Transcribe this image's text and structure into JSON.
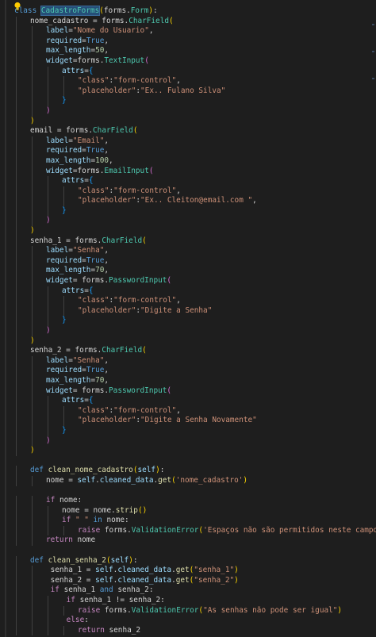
{
  "editor": {
    "theme_colors": {
      "background": "#1e1e1e",
      "keyword": "#569cd6",
      "control": "#c586c0",
      "class": "#4ec9b0",
      "function": "#dcdcaa",
      "string": "#ce9178",
      "number": "#b5cea8",
      "param": "#9cdcfe"
    },
    "lightbulb_icon": "lightbulb-icon",
    "lines": [
      {
        "indent": 0,
        "tokens": [
          [
            "kw",
            "class "
          ],
          [
            "cls hl",
            "CadastroForms"
          ],
          [
            "br1",
            "("
          ],
          [
            "pl",
            "forms."
          ],
          [
            "cls",
            "Form"
          ],
          [
            "br1",
            ")"
          ],
          [
            "pl",
            ":"
          ]
        ]
      },
      {
        "indent": 1,
        "tokens": [
          [
            "pl",
            "nome_cadastro = forms."
          ],
          [
            "cls",
            "CharField"
          ],
          [
            "br1",
            "("
          ]
        ]
      },
      {
        "indent": 2,
        "tokens": [
          [
            "prm",
            "label"
          ],
          [
            "pl",
            "="
          ],
          [
            "str",
            "\"Nome do Usuario\""
          ],
          [
            "pl",
            ","
          ]
        ]
      },
      {
        "indent": 2,
        "tokens": [
          [
            "prm",
            "required"
          ],
          [
            "pl",
            "="
          ],
          [
            "kw",
            "True"
          ],
          [
            "pl",
            ","
          ]
        ]
      },
      {
        "indent": 2,
        "tokens": [
          [
            "prm",
            "max_length"
          ],
          [
            "pl",
            "="
          ],
          [
            "num",
            "50"
          ],
          [
            "pl",
            ","
          ]
        ]
      },
      {
        "indent": 2,
        "tokens": [
          [
            "prm",
            "widget"
          ],
          [
            "pl",
            "=forms."
          ],
          [
            "cls",
            "TextInput"
          ],
          [
            "br2",
            "("
          ]
        ]
      },
      {
        "indent": 3,
        "tokens": [
          [
            "prm",
            "attrs"
          ],
          [
            "pl",
            "="
          ],
          [
            "br3",
            "{"
          ]
        ]
      },
      {
        "indent": 4,
        "tokens": [
          [
            "str",
            "\"class\""
          ],
          [
            "pl",
            ":"
          ],
          [
            "str",
            "\"form-control\""
          ],
          [
            "pl",
            ","
          ]
        ]
      },
      {
        "indent": 4,
        "tokens": [
          [
            "str",
            "\"placeholder\""
          ],
          [
            "pl",
            ":"
          ],
          [
            "str",
            "\"Ex.. Fulano Silva\""
          ]
        ]
      },
      {
        "indent": 3,
        "tokens": [
          [
            "br3",
            "}"
          ]
        ]
      },
      {
        "indent": 2,
        "tokens": [
          [
            "br2",
            ")"
          ]
        ]
      },
      {
        "indent": 1,
        "tokens": [
          [
            "br1",
            ")"
          ]
        ]
      },
      {
        "indent": 1,
        "tokens": [
          [
            "pl",
            "email = forms."
          ],
          [
            "cls",
            "CharField"
          ],
          [
            "br1",
            "("
          ]
        ]
      },
      {
        "indent": 2,
        "tokens": [
          [
            "prm",
            "label"
          ],
          [
            "pl",
            "="
          ],
          [
            "str",
            "\"Email\""
          ],
          [
            "pl",
            ","
          ]
        ]
      },
      {
        "indent": 2,
        "tokens": [
          [
            "prm",
            "required"
          ],
          [
            "pl",
            "="
          ],
          [
            "kw",
            "True"
          ],
          [
            "pl",
            ","
          ]
        ]
      },
      {
        "indent": 2,
        "tokens": [
          [
            "prm",
            "max_length"
          ],
          [
            "pl",
            "="
          ],
          [
            "num",
            "100"
          ],
          [
            "pl",
            ","
          ]
        ]
      },
      {
        "indent": 2,
        "tokens": [
          [
            "prm",
            "widget"
          ],
          [
            "pl",
            "=forms."
          ],
          [
            "cls",
            "EmailInput"
          ],
          [
            "br2",
            "("
          ]
        ]
      },
      {
        "indent": 3,
        "tokens": [
          [
            "prm",
            "attrs"
          ],
          [
            "pl",
            "="
          ],
          [
            "br3",
            "{"
          ]
        ]
      },
      {
        "indent": 4,
        "tokens": [
          [
            "str",
            "\"class\""
          ],
          [
            "pl",
            ":"
          ],
          [
            "str",
            "\"form-control\""
          ],
          [
            "pl",
            ","
          ]
        ]
      },
      {
        "indent": 4,
        "tokens": [
          [
            "str",
            "\"placeholder\""
          ],
          [
            "pl",
            ":"
          ],
          [
            "str",
            "\"Ex.. Cleiton@email.com \""
          ],
          [
            "pl",
            ","
          ]
        ]
      },
      {
        "indent": 3,
        "tokens": [
          [
            "br3",
            "}"
          ]
        ]
      },
      {
        "indent": 2,
        "tokens": [
          [
            "br2",
            ")"
          ]
        ]
      },
      {
        "indent": 1,
        "tokens": [
          [
            "br1",
            ")"
          ]
        ]
      },
      {
        "indent": 1,
        "tokens": [
          [
            "pl",
            "senha_1 = forms."
          ],
          [
            "cls",
            "CharField"
          ],
          [
            "br1",
            "("
          ]
        ]
      },
      {
        "indent": 2,
        "tokens": [
          [
            "prm",
            "label"
          ],
          [
            "pl",
            "="
          ],
          [
            "str",
            "\"Senha\""
          ],
          [
            "pl",
            ","
          ]
        ]
      },
      {
        "indent": 2,
        "tokens": [
          [
            "prm",
            "required"
          ],
          [
            "pl",
            "="
          ],
          [
            "kw",
            "True"
          ],
          [
            "pl",
            ","
          ]
        ]
      },
      {
        "indent": 2,
        "tokens": [
          [
            "prm",
            "max_length"
          ],
          [
            "pl",
            "="
          ],
          [
            "num",
            "70"
          ],
          [
            "pl",
            ","
          ]
        ]
      },
      {
        "indent": 2,
        "tokens": [
          [
            "prm",
            "widget"
          ],
          [
            "pl",
            "= forms."
          ],
          [
            "cls",
            "PasswordInput"
          ],
          [
            "br2",
            "("
          ]
        ]
      },
      {
        "indent": 3,
        "tokens": [
          [
            "prm",
            "attrs"
          ],
          [
            "pl",
            "="
          ],
          [
            "br3",
            "{"
          ]
        ]
      },
      {
        "indent": 4,
        "tokens": [
          [
            "str",
            "\"class\""
          ],
          [
            "pl",
            ":"
          ],
          [
            "str",
            "\"form-control\""
          ],
          [
            "pl",
            ","
          ]
        ]
      },
      {
        "indent": 4,
        "tokens": [
          [
            "str",
            "\"placeholder\""
          ],
          [
            "pl",
            ":"
          ],
          [
            "str",
            "\"Digite a Senha\""
          ]
        ]
      },
      {
        "indent": 3,
        "tokens": [
          [
            "br3",
            "}"
          ]
        ]
      },
      {
        "indent": 2,
        "tokens": [
          [
            "br2",
            ")"
          ]
        ]
      },
      {
        "indent": 1,
        "tokens": [
          [
            "br1",
            ")"
          ]
        ]
      },
      {
        "indent": 1,
        "tokens": [
          [
            "pl",
            "senha_2 = forms."
          ],
          [
            "cls",
            "CharField"
          ],
          [
            "br1",
            "("
          ]
        ]
      },
      {
        "indent": 2,
        "tokens": [
          [
            "prm",
            "label"
          ],
          [
            "pl",
            "="
          ],
          [
            "str",
            "\"Senha\""
          ],
          [
            "pl",
            ","
          ]
        ]
      },
      {
        "indent": 2,
        "tokens": [
          [
            "prm",
            "required"
          ],
          [
            "pl",
            "="
          ],
          [
            "kw",
            "True"
          ],
          [
            "pl",
            ","
          ]
        ]
      },
      {
        "indent": 2,
        "tokens": [
          [
            "prm",
            "max_length"
          ],
          [
            "pl",
            "="
          ],
          [
            "num",
            "70"
          ],
          [
            "pl",
            ","
          ]
        ]
      },
      {
        "indent": 2,
        "tokens": [
          [
            "prm",
            "widget"
          ],
          [
            "pl",
            "= forms."
          ],
          [
            "cls",
            "PasswordInput"
          ],
          [
            "br2",
            "("
          ]
        ]
      },
      {
        "indent": 3,
        "tokens": [
          [
            "prm",
            "attrs"
          ],
          [
            "pl",
            "="
          ],
          [
            "br3",
            "{"
          ]
        ]
      },
      {
        "indent": 4,
        "tokens": [
          [
            "str",
            "\"class\""
          ],
          [
            "pl",
            ":"
          ],
          [
            "str",
            "\"form-control\""
          ],
          [
            "pl",
            ","
          ]
        ]
      },
      {
        "indent": 4,
        "tokens": [
          [
            "str",
            "\"placeholder\""
          ],
          [
            "pl",
            ":"
          ],
          [
            "str",
            "\"Digite a Senha Novamente\""
          ]
        ]
      },
      {
        "indent": 3,
        "tokens": [
          [
            "br3",
            "}"
          ]
        ]
      },
      {
        "indent": 2,
        "tokens": [
          [
            "br2",
            ")"
          ]
        ]
      },
      {
        "indent": 1,
        "tokens": [
          [
            "br1",
            ")"
          ]
        ]
      },
      {
        "indent": 0,
        "tokens": []
      },
      {
        "indent": 1,
        "tokens": [
          [
            "kw",
            "def "
          ],
          [
            "fn",
            "clean_nome_cadastro"
          ],
          [
            "br1",
            "("
          ],
          [
            "self",
            "self"
          ],
          [
            "br1",
            ")"
          ],
          [
            "pl",
            ":"
          ]
        ]
      },
      {
        "indent": 2,
        "tokens": [
          [
            "pl",
            "nome = "
          ],
          [
            "self",
            "self"
          ],
          [
            "pl",
            "."
          ],
          [
            "prm",
            "cleaned_data"
          ],
          [
            "pl",
            "."
          ],
          [
            "fn",
            "get"
          ],
          [
            "br1",
            "("
          ],
          [
            "str",
            "'nome_cadastro'"
          ],
          [
            "br1",
            ")"
          ]
        ]
      },
      {
        "indent": 0,
        "tokens": []
      },
      {
        "indent": 2,
        "tokens": [
          [
            "cf",
            "if "
          ],
          [
            "pl",
            "nome:"
          ]
        ]
      },
      {
        "indent": 3,
        "tokens": [
          [
            "pl",
            "nome = nome."
          ],
          [
            "fn",
            "strip"
          ],
          [
            "br1",
            "()"
          ]
        ]
      },
      {
        "indent": 3,
        "tokens": [
          [
            "cf",
            "if "
          ],
          [
            "str",
            "\" \""
          ],
          [
            "kw",
            " in "
          ],
          [
            "pl",
            "nome:"
          ]
        ]
      },
      {
        "indent": 4,
        "tokens": [
          [
            "cf",
            "raise "
          ],
          [
            "pl",
            "forms."
          ],
          [
            "cls",
            "ValidationError"
          ],
          [
            "br1",
            "("
          ],
          [
            "str",
            "'Espaços não são permitidos neste campo'"
          ],
          [
            "br1",
            ")"
          ]
        ]
      },
      {
        "indent": 2,
        "tokens": [
          [
            "cf",
            "return "
          ],
          [
            "pl",
            "nome"
          ]
        ]
      },
      {
        "indent": 0,
        "tokens": []
      },
      {
        "indent": 1,
        "tokens": [
          [
            "kw",
            "def "
          ],
          [
            "fn",
            "clean_senha_2"
          ],
          [
            "br1",
            "("
          ],
          [
            "self",
            "self"
          ],
          [
            "br1",
            ")"
          ],
          [
            "pl",
            ":"
          ]
        ]
      },
      {
        "indent": 2,
        "tokens": [
          [
            "pl",
            " senha_1 = "
          ],
          [
            "self",
            "self"
          ],
          [
            "pl",
            "."
          ],
          [
            "prm",
            "cleaned_data"
          ],
          [
            "pl",
            "."
          ],
          [
            "fn",
            "get"
          ],
          [
            "br1",
            "("
          ],
          [
            "str",
            "\"senha_1\""
          ],
          [
            "br1",
            ")"
          ]
        ]
      },
      {
        "indent": 2,
        "tokens": [
          [
            "pl",
            " senha_2 = "
          ],
          [
            "self",
            "self"
          ],
          [
            "pl",
            "."
          ],
          [
            "prm",
            "cleaned_data"
          ],
          [
            "pl",
            "."
          ],
          [
            "fn",
            "get"
          ],
          [
            "br1",
            "("
          ],
          [
            "str",
            "\"senha_2\""
          ],
          [
            "br1",
            ")"
          ]
        ]
      },
      {
        "indent": 2,
        "tokens": [
          [
            "cf",
            " if "
          ],
          [
            "pl",
            "senha_1 "
          ],
          [
            "kw",
            "and "
          ],
          [
            "pl",
            "senha_2:"
          ]
        ]
      },
      {
        "indent": 3,
        "tokens": [
          [
            "cf",
            " if "
          ],
          [
            "pl",
            "senha_1 != senha_2:"
          ]
        ]
      },
      {
        "indent": 4,
        "tokens": [
          [
            "cf",
            "raise "
          ],
          [
            "pl",
            "forms."
          ],
          [
            "cls",
            "ValidationError"
          ],
          [
            "br1",
            "("
          ],
          [
            "str",
            "\"As senhas não pode ser igual\""
          ],
          [
            "br1",
            ")"
          ]
        ]
      },
      {
        "indent": 3,
        "tokens": [
          [
            "cf",
            " else"
          ],
          [
            "pl",
            ":"
          ]
        ]
      },
      {
        "indent": 4,
        "tokens": [
          [
            "cf",
            "return "
          ],
          [
            "pl",
            "senha_2"
          ]
        ]
      }
    ]
  }
}
